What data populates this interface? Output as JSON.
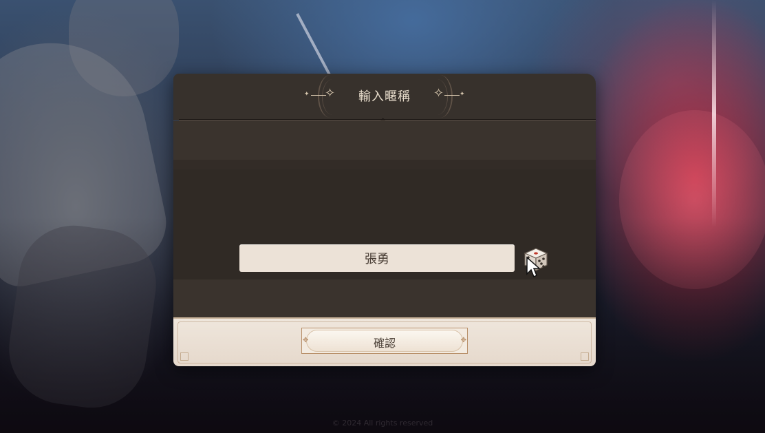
{
  "dialog": {
    "title": "輸入暱稱",
    "name_value": "張勇",
    "randomize_icon": "dice-icon",
    "confirm_label": "確認"
  },
  "footer": {
    "copyright": "© 2024 All rights reserved"
  },
  "colors": {
    "header_bg": "#37312c",
    "body_bg": "#302a25",
    "input_bg": "#ece2d7",
    "footer_bg": "#efe6dc",
    "accent_gold": "#b8906a",
    "title_text": "#e7dccb"
  }
}
